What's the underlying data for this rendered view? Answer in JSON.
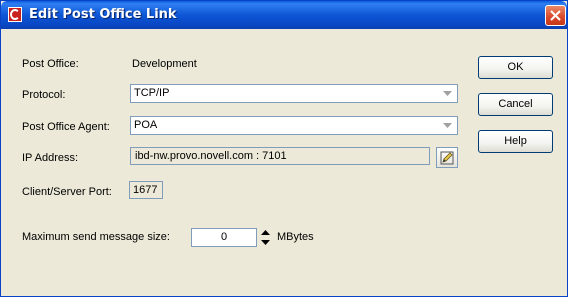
{
  "window": {
    "title": "Edit Post Office Link"
  },
  "post_office": {
    "label": "Post Office:",
    "value": "Development"
  },
  "protocol": {
    "label": "Protocol:",
    "value": "TCP/IP"
  },
  "agent": {
    "label": "Post Office Agent:",
    "value": "POA"
  },
  "ip_address": {
    "label": "IP Address:",
    "value": "ibd-nw.provo.novell.com : 7101"
  },
  "port": {
    "label": "Client/Server Port:",
    "value": "1677"
  },
  "max_size": {
    "label": "Maximum send message size:",
    "value": "0",
    "unit": "MBytes"
  },
  "buttons": {
    "ok": "OK",
    "cancel": "Cancel",
    "help": "Help"
  },
  "icons": {
    "app": "novell-logo-icon",
    "close": "close-icon",
    "dropdown": "chevron-down-icon",
    "edit": "pencil-icon",
    "spin_up": "spin-up-icon",
    "spin_down": "spin-down-icon"
  },
  "colors": {
    "titlebar": "#0a5ddf",
    "close": "#d9482a",
    "dialog_bg": "#ece9d8"
  }
}
